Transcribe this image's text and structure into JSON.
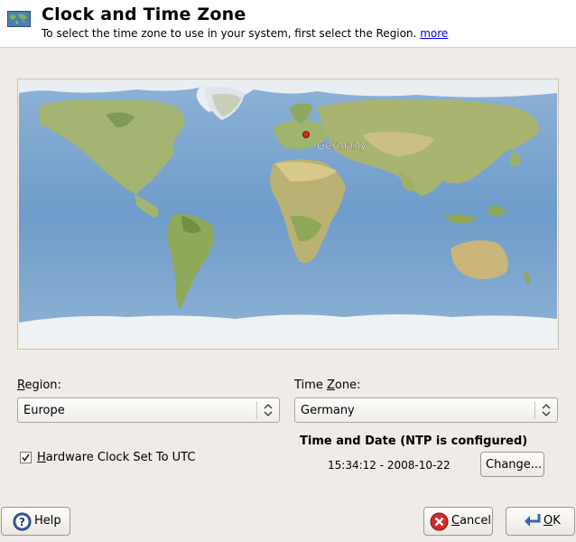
{
  "header": {
    "title": "Clock and Time Zone",
    "subtitle": "To select the time zone to use in your system, first select the Region.",
    "more_link": "more"
  },
  "map": {
    "selected_label": "Germany",
    "ocean_color": "#7fa8cf",
    "land_color": "#a6b472"
  },
  "region": {
    "label_mnemonic": "R",
    "label_rest": "egion:",
    "value": "Europe"
  },
  "timezone": {
    "label_pre": "Time ",
    "label_mnemonic": "Z",
    "label_rest": "one:",
    "value": "Germany"
  },
  "hardware_clock": {
    "label_mnemonic": "H",
    "label_rest": "ardware Clock Set To UTC",
    "checked": true
  },
  "time_date": {
    "heading": "Time and Date (NTP is configured)",
    "value": "15:34:12 - 2008-10-22",
    "change_label": "Change..."
  },
  "buttons": {
    "help": "Help",
    "cancel_mnemonic": "C",
    "cancel_rest": "ancel",
    "ok_mnemonic": "O",
    "ok_rest": "K"
  },
  "icons": {
    "header": "world-map-icon",
    "help": "help-icon",
    "cancel": "cancel-icon",
    "ok": "ok-enter-icon"
  }
}
